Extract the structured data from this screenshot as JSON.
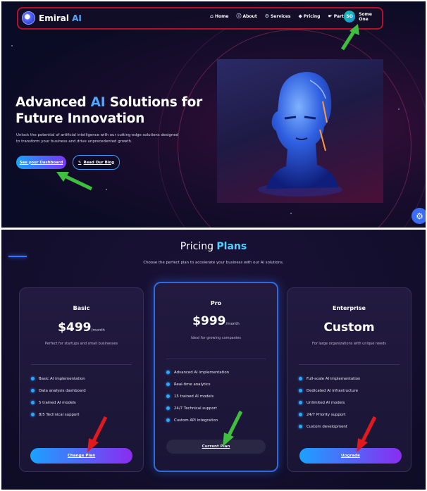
{
  "nav": {
    "logo_name": "Emiral",
    "logo_ai": "AI",
    "links": [
      {
        "label": "Home",
        "icon": "home-icon",
        "glyph": "⌂"
      },
      {
        "label": "About",
        "icon": "info-icon",
        "glyph": "ⓘ"
      },
      {
        "label": "Services",
        "icon": "services-icon",
        "glyph": "⚙"
      },
      {
        "label": "Pricing",
        "icon": "tag-icon",
        "glyph": "◆"
      },
      {
        "label": "Partners",
        "icon": "handshake-icon",
        "glyph": "☛"
      }
    ],
    "user_initials": "SO",
    "user_name": "Some One"
  },
  "hero": {
    "title_part1": "Advanced ",
    "title_accent": "AI",
    "title_part2": " Solutions for",
    "title_line2": "Future Innovation",
    "description": "Unlock the potential of artificial intelligence with our cutting-edge solutions designed to transform your business and drive unprecedented growth.",
    "primary_button": "See your Dashboard",
    "secondary_button": "Read Our Blog"
  },
  "pricing": {
    "title": "Pricing",
    "title_accent": "Plans",
    "subtitle": "Choose the perfect plan to accelerate your business with our AI solutions.",
    "plans": [
      {
        "name": "Basic",
        "price": "$499",
        "period": "/month",
        "description": "Perfect for startups and small businesses",
        "features": [
          "Basic AI implementation",
          "Data analysis dashboard",
          "5 trained AI models",
          "8/5 Technical support"
        ],
        "button": "Change Plan"
      },
      {
        "name": "Pro",
        "price": "$999",
        "period": "/month",
        "description": "Ideal for growing companies",
        "features": [
          "Advanced AI implementation",
          "Real-time analytics",
          "15 trained AI models",
          "24/7 Technical support",
          "Custom API integration"
        ],
        "button": "Current Plan"
      },
      {
        "name": "Enterprise",
        "price": "Custom",
        "period": "",
        "description": "For large organizations with unique needs",
        "features": [
          "Full-scale AI implementation",
          "Dedicated AI infrastructure",
          "Unlimited AI models",
          "24/7 Priority support",
          "Custom development"
        ],
        "button": "Upgrade"
      }
    ]
  },
  "colors": {
    "accent": "#4da8ff",
    "nav_outline": "#b2112b",
    "annotation_green": "#3fbf3f",
    "annotation_red": "#e0191f"
  }
}
